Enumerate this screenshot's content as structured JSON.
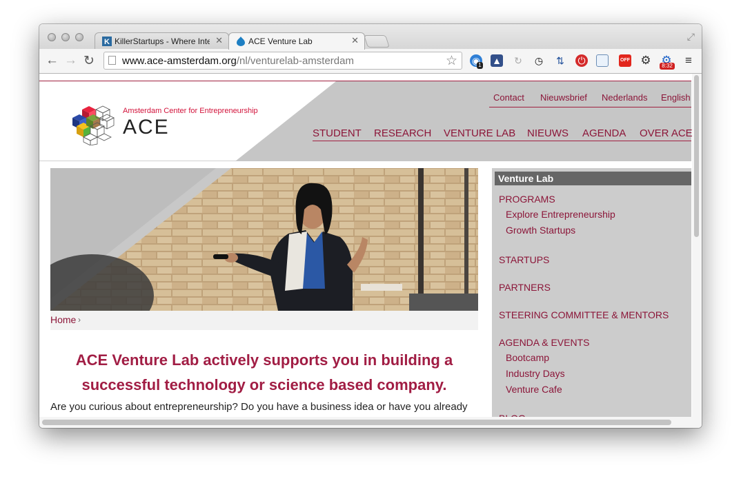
{
  "browser": {
    "tabs": [
      {
        "title": "KillerStartups - Where Inte",
        "active": false
      },
      {
        "title": "ACE Venture Lab",
        "active": true
      }
    ],
    "url_domain": "www.ace-amsterdam.org",
    "url_path": "/nl/venturelab-amsterdam",
    "extensions": [
      {
        "icon": "ghostery-icon",
        "badge": "1"
      },
      {
        "icon": "translate-icon"
      },
      {
        "icon": "reload-ext-icon"
      },
      {
        "icon": "timer-icon"
      },
      {
        "icon": "download-icon"
      },
      {
        "icon": "stop-icon"
      },
      {
        "icon": "window-icon"
      },
      {
        "icon": "off-toggle-icon",
        "badge": "OFF"
      },
      {
        "icon": "settings-gear-icon"
      },
      {
        "icon": "time-gear-icon",
        "badge": "8:32"
      },
      {
        "icon": "menu-icon"
      }
    ]
  },
  "site": {
    "logo_subtitle": "Amsterdam Center for Entrepreneurship",
    "logo_name": "ACE",
    "top_links": [
      "Contact",
      "Nieuwsbrief",
      "Nederlands",
      "English"
    ],
    "main_nav": [
      "STUDENT",
      "RESEARCH",
      "VENTURE LAB",
      "NIEUWS",
      "AGENDA",
      "OVER ACE"
    ],
    "breadcrumb_home": "Home",
    "breadcrumb_sep": "›",
    "headline_1": "ACE Venture Lab actively supports you in building a",
    "headline_2": "successful technology or science based company.",
    "intro": "Are you curious about entrepreneurship? Do you have a business idea or have you already"
  },
  "sidebar": {
    "title": "Venture Lab",
    "items": [
      {
        "label": "PROGRAMS",
        "level": 0
      },
      {
        "label": "Explore Entrepreneurship",
        "level": 1
      },
      {
        "label": "Growth Startups",
        "level": 1
      },
      {
        "label": "STARTUPS",
        "level": 0
      },
      {
        "label": "PARTNERS",
        "level": 0
      },
      {
        "label": "STEERING COMMITTEE & MENTORS",
        "level": 0
      },
      {
        "label": "AGENDA & EVENTS",
        "level": 0
      },
      {
        "label": "Bootcamp",
        "level": 1
      },
      {
        "label": "Industry Days",
        "level": 1
      },
      {
        "label": "Venture Cafe",
        "level": 1
      },
      {
        "label": "BLOG",
        "level": 0
      }
    ]
  },
  "colors": {
    "brand": "#8b1538",
    "headline": "#a11d44",
    "sidebar_bg": "#cccccc",
    "sidebar_head": "#666666"
  }
}
